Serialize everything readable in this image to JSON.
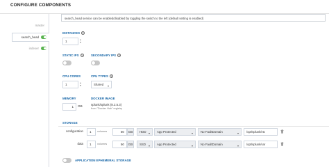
{
  "page": {
    "title": "CONFIGURE COMPONENTS"
  },
  "sidebar": {
    "items": [
      {
        "label": "master",
        "active": false,
        "toggle": false
      },
      {
        "label": "search_head",
        "active": true,
        "toggle": true
      },
      {
        "label": "indexer",
        "active": false,
        "toggle": true
      }
    ]
  },
  "info": {
    "text": "search_head service can be enabled/disabled by toggling the switch to the left (default setting is enabled)"
  },
  "instances": {
    "label": "INSTANCES",
    "value": "1"
  },
  "static_ips": {
    "label": "STATIC IPS",
    "enabled": false
  },
  "secondary_ips": {
    "label": "SECONDARY IPS",
    "enabled": false
  },
  "cpu_cores": {
    "label": "CPU CORES",
    "value": "1"
  },
  "cpu_types": {
    "label": "CPU TYPES",
    "value": "Shared"
  },
  "memory": {
    "label": "MEMORY",
    "value": "1",
    "unit": "GB"
  },
  "docker_image": {
    "label": "DOCKER IMAGE",
    "name": "splunk/splunk (8.2.5.3)",
    "source": "from \"Docker Hub\" registry"
  },
  "storage": {
    "label": "STORAGE",
    "rows": [
      {
        "name": "configuration",
        "count": "1",
        "count_unit": "volumes",
        "size": "50",
        "size_unit": "GB",
        "disk": "HDD",
        "protection": "App Protected",
        "fault_domain": "No FaultDomain",
        "path": "/opt/splunk/etc"
      },
      {
        "name": "data",
        "count": "1",
        "count_unit": "volumes",
        "size": "50",
        "size_unit": "GB",
        "disk": "SSD",
        "protection": "App Protected",
        "fault_domain": "No FaultDomain",
        "path": "/opt/splunk/var"
      }
    ]
  },
  "ephemeral": {
    "label": "APPLICATION EPHEMERAL STORAGE",
    "enabled": false
  },
  "icons": {
    "help": "question-circle-icon",
    "caret": "chevron-down-icon",
    "trash": "trash-icon"
  },
  "colors": {
    "accent": "#1565a7",
    "toggle_on": "#58b34f",
    "toggle_off": "#c7c7c7"
  }
}
